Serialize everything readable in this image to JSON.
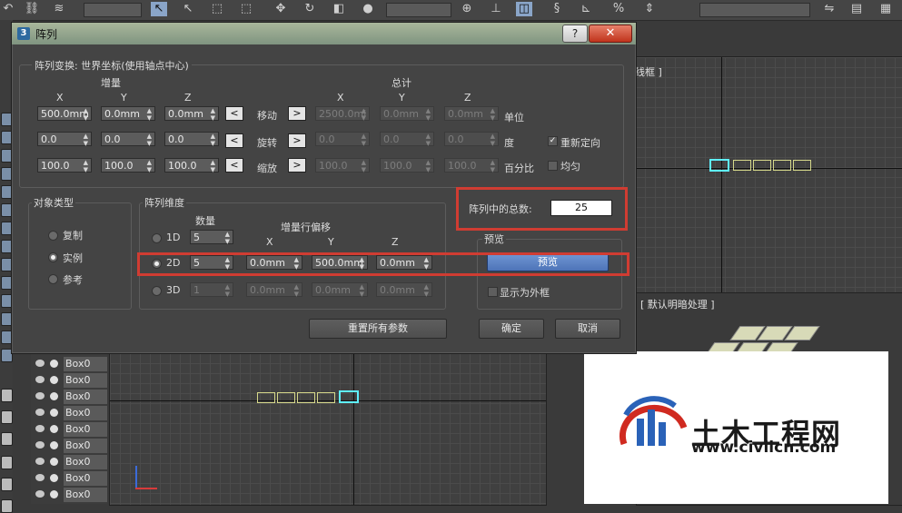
{
  "app": {
    "viewport_top_right_label": "线框 ]",
    "viewport_bottom_right_label": "[ 默认明暗处理 ]",
    "scene_items": [
      "Box0",
      "Box0",
      "Box0",
      "Box0",
      "Box0",
      "Box0",
      "Box0",
      "Box0",
      "Box0"
    ]
  },
  "watermark": {
    "name": "土木工程网",
    "url": "www.civilcn.com"
  },
  "dialog": {
    "icon_text": "3",
    "title": "阵列",
    "help_label": "?",
    "close_label": "✕",
    "transform_group_label": "阵列变换: 世界坐标(使用轴点中心)",
    "increment_label": "增量",
    "totals_label": "总计",
    "axis_labels": [
      "X",
      "Y",
      "Z"
    ],
    "rows": [
      {
        "name": "移动",
        "inc": [
          "500.0mm",
          "0.0mm",
          "0.0mm"
        ],
        "totals": [
          "2500.0mi",
          "0.0mm",
          "0.0mm"
        ],
        "unit": "单位"
      },
      {
        "name": "旋转",
        "inc": [
          "0.0",
          "0.0",
          "0.0"
        ],
        "totals": [
          "0.0",
          "0.0",
          "0.0"
        ],
        "unit": "度"
      },
      {
        "name": "缩放",
        "inc": [
          "100.0",
          "100.0",
          "100.0"
        ],
        "totals": [
          "100.0",
          "100.0",
          "100.0"
        ],
        "unit": "百分比"
      }
    ],
    "left_arrow": "<",
    "right_arrow": ">",
    "reorient_label": "重新定向",
    "uniform_label": "均匀",
    "object_type_label": "对象类型",
    "object_types": [
      "复制",
      "实例",
      "参考"
    ],
    "object_type_selected": "实例",
    "dimensions_label": "阵列维度",
    "count_label": "数量",
    "offset_label": "增量行偏移",
    "dims": [
      {
        "label": "1D",
        "count": "5"
      },
      {
        "label": "2D",
        "count": "5",
        "offsets": [
          "0.0mm",
          "500.0mm",
          "0.0mm"
        ]
      },
      {
        "label": "3D",
        "count": "1",
        "offsets": [
          "0.0mm",
          "0.0mm",
          "0.0mm"
        ]
      }
    ],
    "dim_selected": "2D",
    "total_label": "阵列中的总数:",
    "total_value": "25",
    "preview_group_label": "预览",
    "preview_button": "预览",
    "show_as_box_label": "显示为外框",
    "reset_button": "重置所有参数",
    "ok_button": "确定",
    "cancel_button": "取消"
  },
  "colors": {
    "highlight": "#d03c32",
    "accent": "#5ff0ff",
    "close": "#c0341c"
  }
}
